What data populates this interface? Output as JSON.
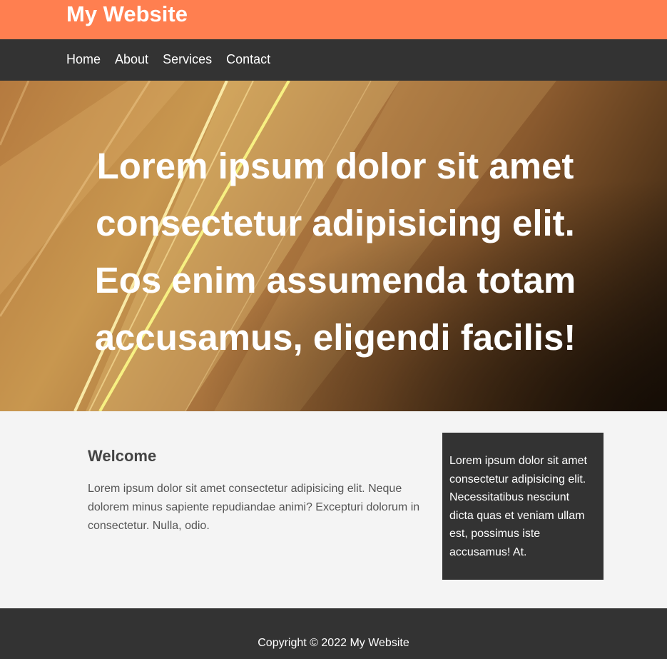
{
  "header": {
    "title": "My Website"
  },
  "nav": {
    "items": [
      {
        "label": "Home"
      },
      {
        "label": "About"
      },
      {
        "label": "Services"
      },
      {
        "label": "Contact"
      }
    ]
  },
  "hero": {
    "text": "Lorem ipsum dolor sit amet consectetur adipisicing elit. Eos enim assumenda totam accusamus, eligendi facilis!"
  },
  "main": {
    "welcome_title": "Welcome",
    "welcome_body": "Lorem ipsum dolor sit amet consectetur adipisicing elit. Neque dolorem minus sapiente repudiandae animi? Excepturi dolorum in consectetur. Nulla, odio."
  },
  "sidebar": {
    "text": "Lorem ipsum dolor sit amet consectetur adipisicing elit. Necessitatibus nesciunt dicta quas et veniam ullam est, possimus iste accusamus! At."
  },
  "footer": {
    "copyright": "Copyright © 2022 My Website"
  },
  "colors": {
    "header_bg": "#ff7f50",
    "nav_bg": "#333333",
    "page_bg": "#f4f4f4",
    "sidebar_bg": "#333333",
    "footer_bg": "#333333"
  }
}
